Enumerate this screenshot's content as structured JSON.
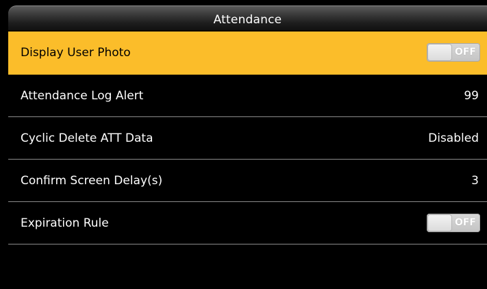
{
  "header": {
    "title": "Attendance"
  },
  "colors": {
    "selected_row": "#fbbd2a",
    "background": "#000000",
    "divider": "#8c8c8c"
  },
  "items": [
    {
      "label": "Display User Photo",
      "control": "toggle",
      "value": "OFF",
      "selected": true
    },
    {
      "label": "Attendance Log Alert",
      "control": "value",
      "value": "99",
      "selected": false
    },
    {
      "label": "Cyclic Delete ATT Data",
      "control": "value",
      "value": "Disabled",
      "selected": false
    },
    {
      "label": "Confirm Screen Delay(s)",
      "control": "value",
      "value": "3",
      "selected": false
    },
    {
      "label": "Expiration Rule",
      "control": "toggle",
      "value": "OFF",
      "selected": false
    }
  ]
}
